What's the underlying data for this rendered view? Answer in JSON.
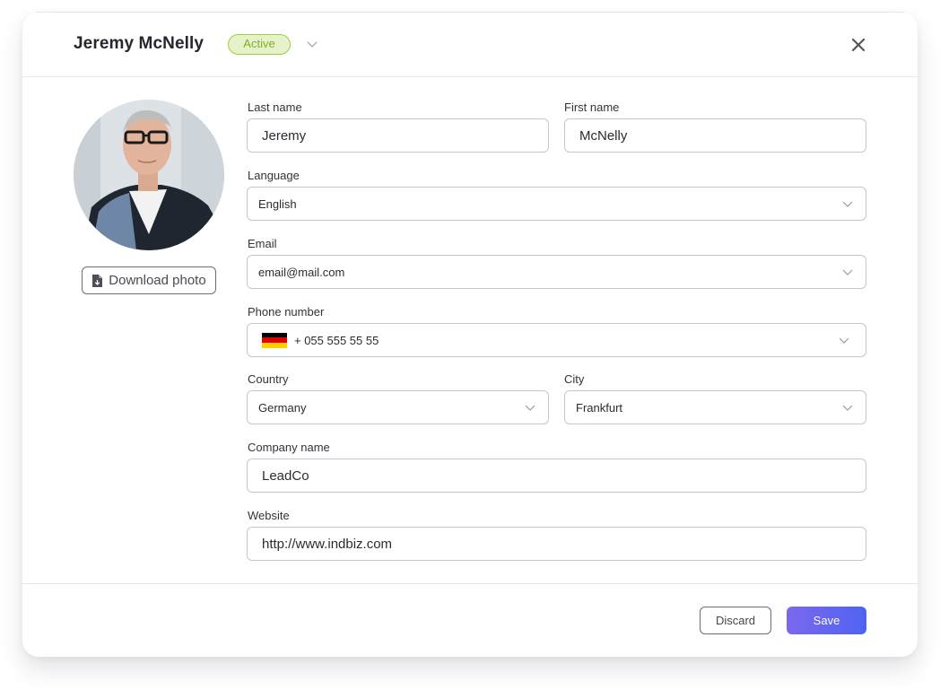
{
  "header": {
    "name": "Jeremy McNelly",
    "status": "Active",
    "status_icon": "chevron-down-icon",
    "close_icon": "close-icon"
  },
  "profile": {
    "photo_alt": "Profile photo of Jeremy McNelly",
    "download_label": "Download photo",
    "download_icon": "file-download-icon"
  },
  "form": {
    "last_name": {
      "label": "Last name",
      "value": "Jeremy"
    },
    "first_name": {
      "label": "First name",
      "value": "McNelly"
    },
    "language": {
      "label": "Language",
      "value": "English"
    },
    "email": {
      "label": "Email",
      "value": "email@mail.com"
    },
    "phone": {
      "label": "Phone number",
      "flag": "germany-flag",
      "value": "+ 055 555 55 55"
    },
    "country": {
      "label": "Country",
      "value": "Germany"
    },
    "city": {
      "label": "City",
      "value": "Frankfurt"
    },
    "company": {
      "label": "Company name",
      "value": "LeadCo"
    },
    "website": {
      "label": "Website",
      "value": "http://www.indbiz.com"
    }
  },
  "footer": {
    "discard_label": "Discard",
    "save_label": "Save"
  },
  "colors": {
    "accent_start": "#7b68ee",
    "accent_end": "#4f63f0",
    "status_green": "#9ccd47",
    "status_bg": "#e6f3c8",
    "flag_black": "#000000",
    "flag_red": "#dd0000",
    "flag_gold": "#ffce00"
  }
}
